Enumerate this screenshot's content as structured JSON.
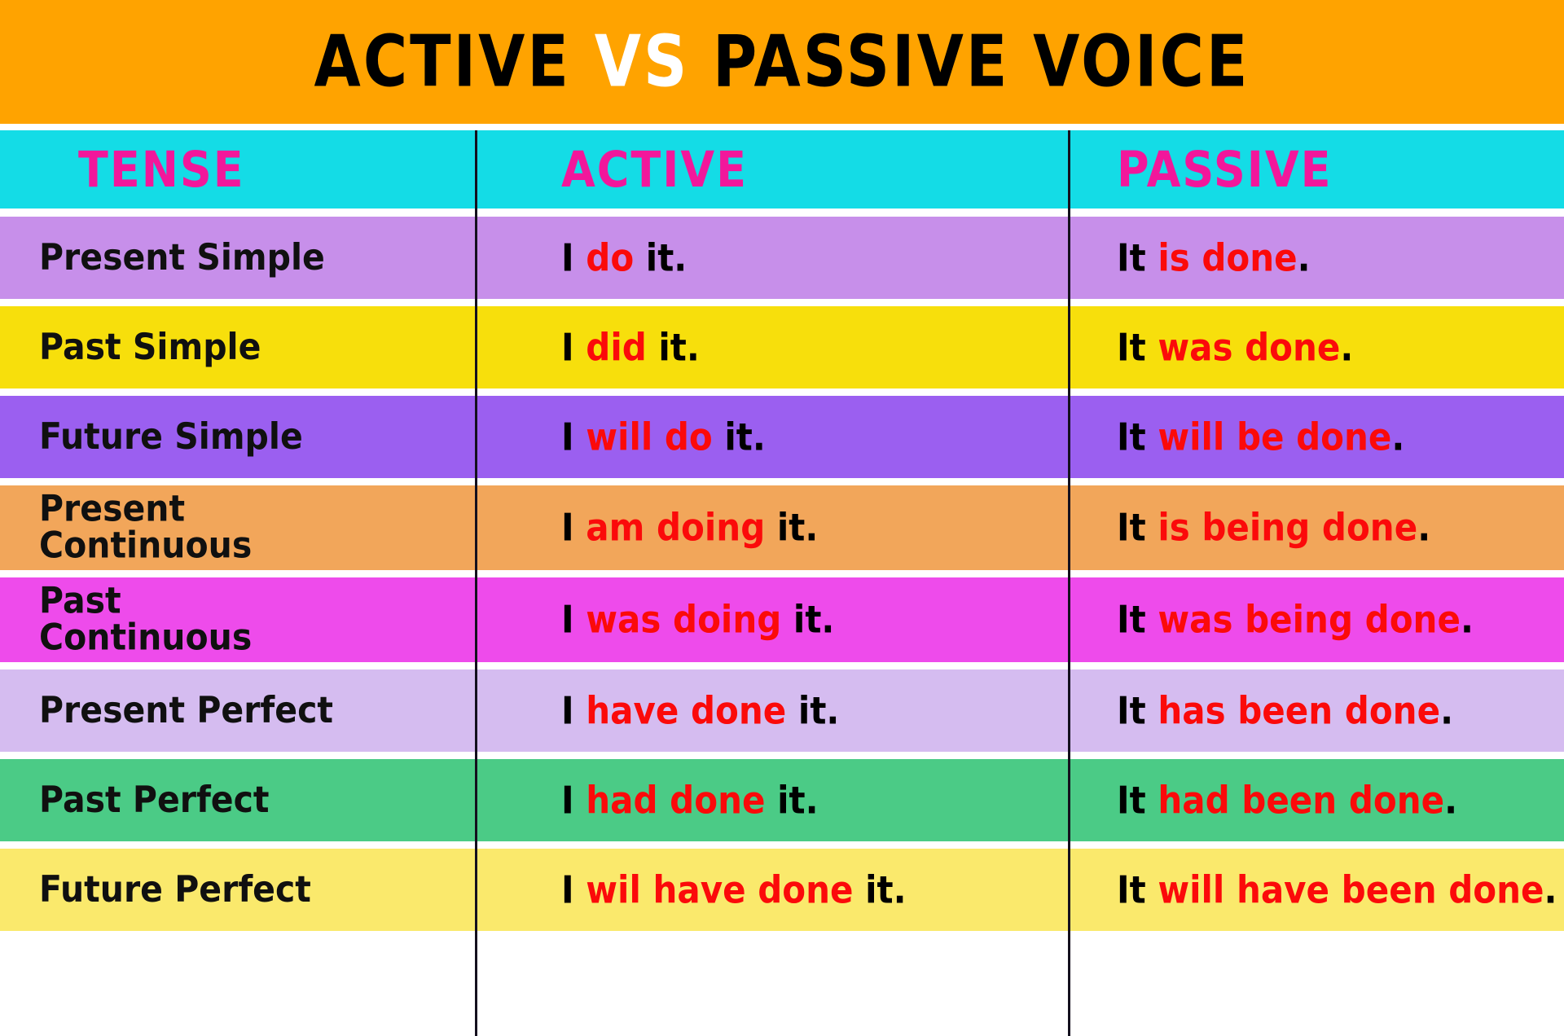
{
  "title": {
    "part1": "ACTIVE ",
    "vs": "VS",
    "part2": " PASSIVE VOICE",
    "banner_color": "#FFA300",
    "vs_color": "#FFFFFF",
    "text_color": "#000000"
  },
  "header": {
    "tense": "TENSE",
    "active": "ACTIVE",
    "passive": "PASSIVE",
    "background": "#14DCE6",
    "text_color": "#F2179B"
  },
  "accent": {
    "highlight_red": "#FB0A0A",
    "body_black": "#000000"
  },
  "rows": [
    {
      "tense": "Present Simple",
      "active_pre": "I ",
      "active_hl": "do",
      "active_post": " it.",
      "passive_pre": "It ",
      "passive_hl": "is done",
      "passive_post": ".",
      "color": "#C78FEA"
    },
    {
      "tense": "Past Simple",
      "active_pre": "I ",
      "active_hl": "did",
      "active_post": " it.",
      "passive_pre": "It ",
      "passive_hl": "was done",
      "passive_post": ".",
      "color": "#F7DF0C"
    },
    {
      "tense": "Future Simple",
      "active_pre": "I ",
      "active_hl": "will do",
      "active_post": " it.",
      "passive_pre": "It ",
      "passive_hl": "will be done",
      "passive_post": ".",
      "color": "#9B5FF0"
    },
    {
      "tense": "Present\nContinuous",
      "active_pre": "I ",
      "active_hl": "am doing",
      "active_post": " it.",
      "passive_pre": "It ",
      "passive_hl": "is being done",
      "passive_post": ".",
      "color": "#F2A65A"
    },
    {
      "tense": "Past\nContinuous",
      "active_pre": "I ",
      "active_hl": "was doing",
      "active_post": " it.",
      "passive_pre": "It ",
      "passive_hl": "was being done",
      "passive_post": ".",
      "color": "#EE4BEB"
    },
    {
      "tense": "Present Perfect",
      "active_pre": "I ",
      "active_hl": "have done",
      "active_post": " it.",
      "passive_pre": "It ",
      "passive_hl": "has been done",
      "passive_post": ".",
      "color": "#D5BCF0"
    },
    {
      "tense": "Past Perfect",
      "active_pre": "I ",
      "active_hl": "had done",
      "active_post": " it.",
      "passive_pre": "It ",
      "passive_hl": "had been done",
      "passive_post": ".",
      "color": "#4BCB86"
    },
    {
      "tense": "Future Perfect",
      "active_pre": "I ",
      "active_hl": "wil have done",
      "active_post": " it.",
      "passive_pre": "It ",
      "passive_hl": "will have been done",
      "passive_post": ".",
      "color": "#FAE96C"
    }
  ]
}
